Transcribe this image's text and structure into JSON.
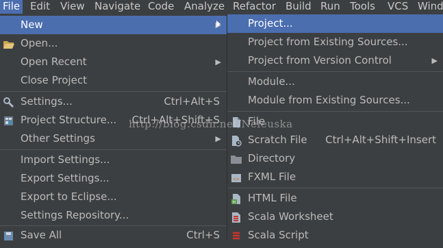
{
  "menubar": [
    "File",
    "Edit",
    "View",
    "Navigate",
    "Code",
    "Analyze",
    "Refactor",
    "Build",
    "Run",
    "Tools",
    "VCS",
    "Wind"
  ],
  "file_menu": {
    "new": "New",
    "open": "Open...",
    "open_recent": "Open Recent",
    "close_project": "Close Project",
    "settings": "Settings...",
    "settings_sc": "Ctrl+Alt+S",
    "project_structure": "Project Structure...",
    "project_structure_sc": "Ctrl+Alt+Shift+S",
    "other_settings": "Other Settings",
    "import_settings": "Import Settings...",
    "export_settings": "Export Settings...",
    "export_eclipse": "Export to Eclipse...",
    "settings_repository": "Settings Repository...",
    "save_all": "Save All",
    "save_all_sc": "Ctrl+S"
  },
  "new_menu": {
    "project": "Project...",
    "project_existing": "Project from Existing Sources...",
    "project_vcs": "Project from Version Control",
    "module": "Module...",
    "module_existing": "Module from Existing Sources...",
    "file": "File",
    "scratch_file": "Scratch File",
    "scratch_file_sc": "Ctrl+Alt+Shift+Insert",
    "directory": "Directory",
    "fxml_file": "FXML File",
    "html_file": "HTML File",
    "scala_worksheet": "Scala Worksheet",
    "scala_script": "Scala Script"
  },
  "watermark": "http://blog.csdn.net/Neleuska",
  "colors": {
    "menu_bg": "#3c3f41",
    "selection": "#4b6eaf",
    "text": "#bbbbbb",
    "separator": "#515658"
  }
}
